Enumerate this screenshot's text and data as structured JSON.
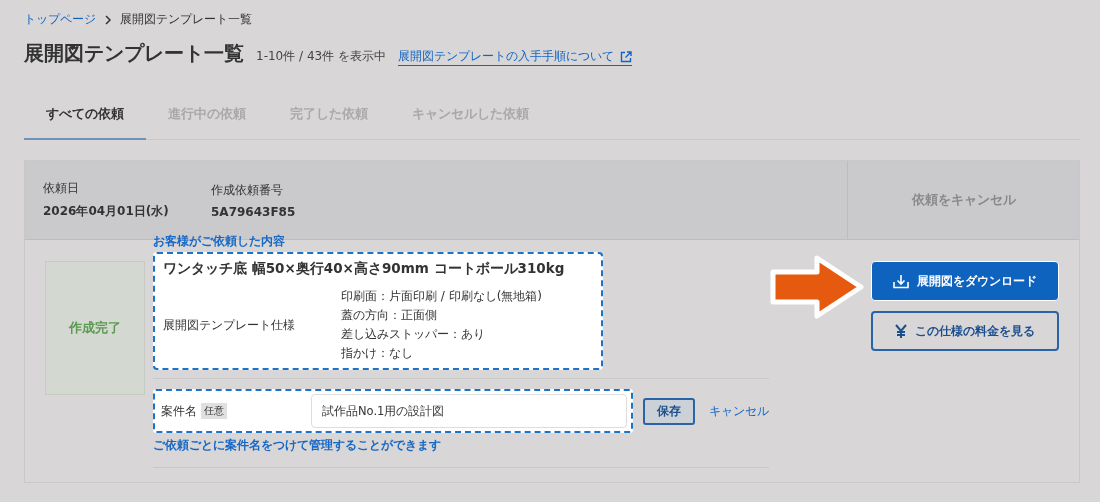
{
  "breadcrumb": [
    {
      "label": "トップページ",
      "kind": "link"
    },
    {
      "label": "展開図テンプレート一覧",
      "kind": "current"
    }
  ],
  "page": {
    "title": "展開図テンプレート一覧",
    "count": "1-10件 / 43件 を表示中",
    "help_link": "展開図テンプレートの入手手順について"
  },
  "tabs": [
    {
      "label": "すべての依頼",
      "selected": true
    },
    {
      "label": "進行中の依頼",
      "selected": false
    },
    {
      "label": "完了した依頼",
      "selected": false
    },
    {
      "label": "キャンセルした依頼",
      "selected": false
    }
  ],
  "request": {
    "date_label": "依頼日",
    "date": "2026年04月01日(水)",
    "number_label": "作成依頼番号",
    "number": "5A79643F85",
    "cancel_button": {
      "label": "依頼をキャンセル",
      "disabled": true
    },
    "status": "作成完了",
    "spec_annotation": "お客様がご依頼した内容",
    "product": "ワンタッチ底 幅50×奥行40×高さ90mm コートボール310kg",
    "spec_label": "展開図テンプレート仕様",
    "spec_lines": [
      "印刷面：片面印刷 / 印刷なし(無地箱)",
      "蓋の方向：正面側",
      "差し込みストッパー：あり",
      "指かけ：なし"
    ],
    "name_label": "案件名",
    "name_badge": "任意",
    "name_value": "試作品No.1用の設計図",
    "save_button": "保存",
    "cancel_link": "キャンセル",
    "name_annotation": "ご依頼ごとに案件名をつけて管理することができます",
    "download_button": "展開図をダウンロード",
    "price_button": "この仕様の料金を見る"
  }
}
